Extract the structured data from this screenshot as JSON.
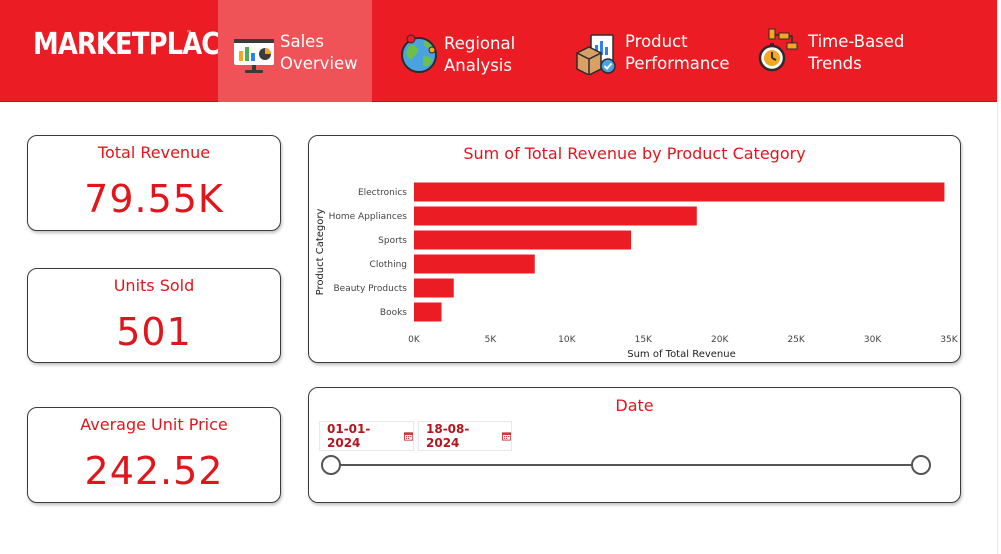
{
  "header": {
    "logo": "MARKETPLACE",
    "logo_mark": "™",
    "nav": [
      {
        "label": "Sales\nOverview",
        "icon": "presentation-chart-icon",
        "active": true
      },
      {
        "label": "Regional\nAnalysis",
        "icon": "globe-icon",
        "active": false
      },
      {
        "label": "Product\nPerformance",
        "icon": "product-box-icon",
        "active": false
      },
      {
        "label": "Time-Based\nTrends",
        "icon": "stopwatch-flowchart-icon",
        "active": false
      }
    ]
  },
  "kpis": {
    "revenue": {
      "title": "Total Revenue",
      "value": "79.55K"
    },
    "units": {
      "title": "Units Sold",
      "value": "501"
    },
    "avg_price": {
      "title": "Average Unit Price",
      "value": "242.52"
    }
  },
  "chart_data": {
    "type": "bar",
    "orientation": "horizontal",
    "title": "Sum of Total Revenue by Product Category",
    "xlabel": "Sum of Total Revenue",
    "ylabel": "Product Category",
    "categories": [
      "Electronics",
      "Home Appliances",
      "Sports",
      "Clothing",
      "Beauty Products",
      "Books"
    ],
    "values": [
      34700,
      18500,
      14200,
      7900,
      2600,
      1800
    ],
    "xlim": [
      0,
      35000
    ],
    "xticks": [
      0,
      5000,
      10000,
      15000,
      20000,
      25000,
      30000,
      35000
    ],
    "xtick_labels": [
      "0K",
      "5K",
      "10K",
      "15K",
      "20K",
      "25K",
      "30K",
      "35K"
    ],
    "grid": false,
    "color": "#ec1c24"
  },
  "date_filter": {
    "title": "Date",
    "start": "01-01-2024",
    "end": "18-08-2024",
    "icon": "calendar-icon"
  },
  "colors": {
    "brand": "#ec1c24",
    "active_tab": "#ef5257",
    "accent_text": "#e0161c"
  }
}
